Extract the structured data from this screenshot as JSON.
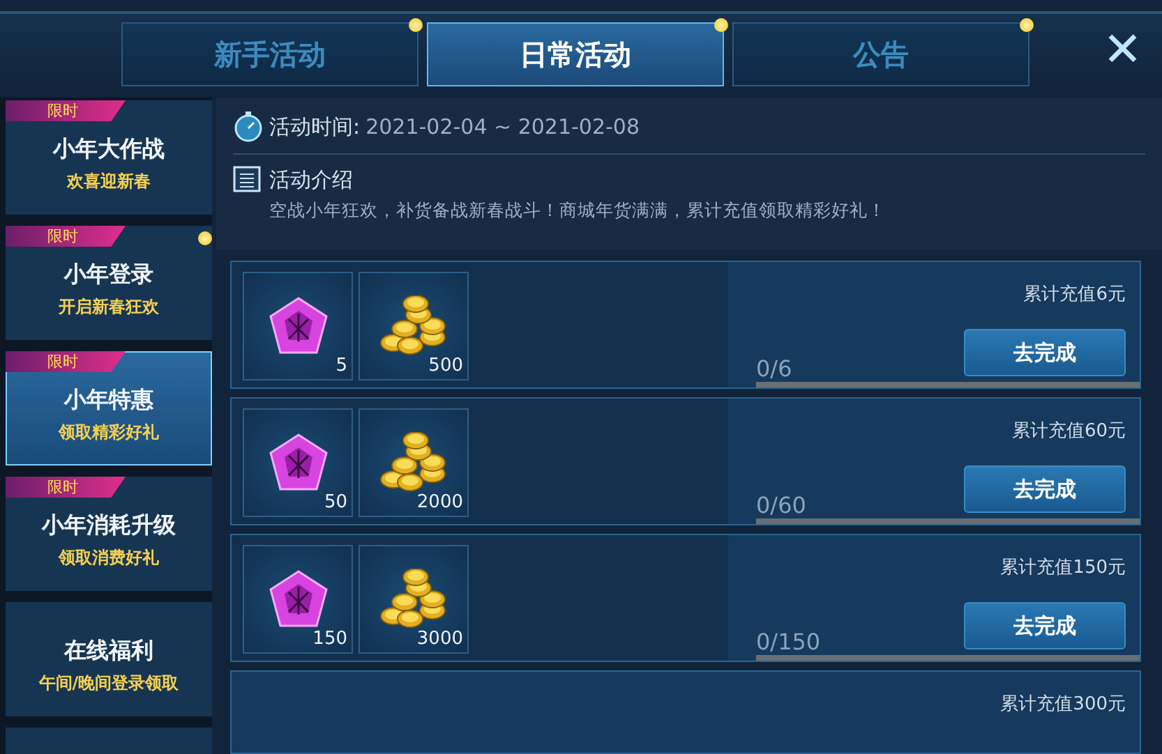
{
  "tabs": [
    {
      "label": "新手活动",
      "selected": false,
      "notify": true
    },
    {
      "label": "日常活动",
      "selected": true,
      "notify": true
    },
    {
      "label": "公告",
      "selected": false,
      "notify": true
    }
  ],
  "close": "✕",
  "sidebar": {
    "items": [
      {
        "badge": "限时",
        "title": "小年大作战",
        "subtitle": "欢喜迎新春",
        "selected": false,
        "notify": false
      },
      {
        "badge": "限时",
        "title": "小年登录",
        "subtitle": "开启新春狂欢",
        "selected": false,
        "notify": true
      },
      {
        "badge": "限时",
        "title": "小年特惠",
        "subtitle": "领取精彩好礼",
        "selected": true,
        "notify": false
      },
      {
        "badge": "限时",
        "title": "小年消耗升级",
        "subtitle": "领取消费好礼",
        "selected": false,
        "notify": false
      },
      {
        "title": "在线福利",
        "subtitle": "午间/晚间登录领取",
        "selected": false,
        "notify": false
      }
    ]
  },
  "info": {
    "time_label": "活动时间:",
    "time_value": "2021-02-04 ~ 2021-02-08",
    "intro_title": "活动介绍",
    "intro_text": "空战小年狂欢，补货备战新春战斗！商城年货满满，累计充值领取精彩好礼！"
  },
  "tasks": [
    {
      "rewards": [
        {
          "kind": "gem",
          "count": "5"
        },
        {
          "kind": "coins",
          "count": "500"
        }
      ],
      "goal": "累计充值6元",
      "progress": "0/6",
      "level": 0,
      "button": "去完成"
    },
    {
      "rewards": [
        {
          "kind": "gem",
          "count": "50"
        },
        {
          "kind": "coins",
          "count": "2000"
        }
      ],
      "goal": "累计充值60元",
      "progress": "0/60",
      "level": 0,
      "button": "去完成"
    },
    {
      "rewards": [
        {
          "kind": "gem",
          "count": "150"
        },
        {
          "kind": "coins",
          "count": "3000"
        }
      ],
      "goal": "累计充值150元",
      "progress": "0/150",
      "level": 0,
      "button": "去完成"
    },
    {
      "goal": "累计充值300元"
    }
  ]
}
